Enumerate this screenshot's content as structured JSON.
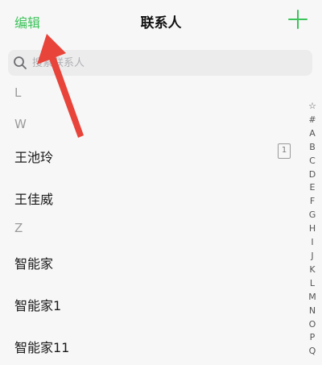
{
  "nav": {
    "edit_label": "编辑",
    "title": "联系人"
  },
  "search": {
    "placeholder": "搜索联系人"
  },
  "sections": {
    "l": "L",
    "w": "W",
    "z": "Z"
  },
  "contacts": [
    {
      "name": "王池玲",
      "badge": "1"
    },
    {
      "name": "王佳威"
    },
    {
      "name": "智能家"
    },
    {
      "name": "智能家1"
    },
    {
      "name": "智能家11"
    }
  ],
  "index": [
    "☆",
    "#",
    "A",
    "B",
    "C",
    "D",
    "E",
    "F",
    "G",
    "H",
    "I",
    "J",
    "K",
    "L",
    "M",
    "N",
    "O",
    "P",
    "Q"
  ],
  "colors": {
    "accent": "#3cc35a",
    "annotation_arrow": "#e8443a"
  }
}
